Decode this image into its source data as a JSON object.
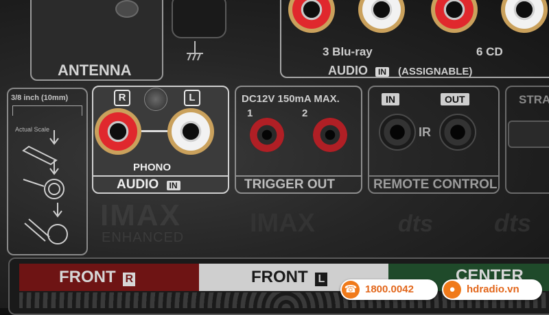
{
  "antenna": {
    "label": "ANTENNA"
  },
  "audio_in_top": {
    "label": "AUDIO",
    "tag": "IN",
    "note": "(ASSIGNABLE)",
    "inputs": [
      "3 Blu-ray",
      "6 CD"
    ]
  },
  "wire_guide": {
    "size": "3/8 inch (10mm)",
    "scale": "Actual Scale"
  },
  "phono": {
    "channel_right": "R",
    "channel_left": "L",
    "label": "PHONO",
    "section": "AUDIO",
    "tag": "IN"
  },
  "trigger": {
    "spec": "DC12V 150mA MAX.",
    "ports": [
      "1",
      "2"
    ],
    "label": "TRIGGER OUT"
  },
  "remote": {
    "in": "IN",
    "out": "OUT",
    "ir": "IR",
    "label": "REMOTE CONTROL"
  },
  "partial": {
    "label": "STRA"
  },
  "logos": {
    "imax_1": "IMAX",
    "imax_enhanced": "ENHANCED",
    "imax_2": "IMAX",
    "dts_1": "dts",
    "dts_2": "dts"
  },
  "speakers": {
    "front_right": "FRONT",
    "front_right_tag": "R",
    "front_left": "FRONT",
    "front_left_tag": "L",
    "center": "CENTER"
  },
  "contact": {
    "phone": "1800.0042",
    "website": "hdradio.vn",
    "accent": "#f07a1a"
  }
}
